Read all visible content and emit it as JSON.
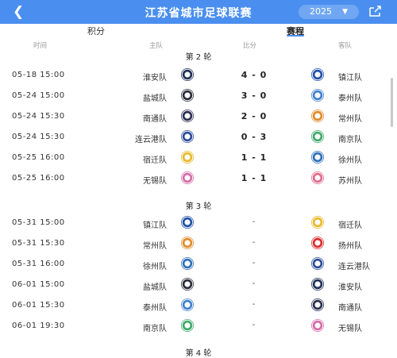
{
  "header": {
    "title": "江苏省城市足球联赛",
    "year": "2025",
    "back_icon": "chevron-left-icon",
    "share_icon": "share-icon"
  },
  "tabs": [
    {
      "label": "积分"
    },
    {
      "label": "赛程"
    }
  ],
  "columns": {
    "time": "时间",
    "home": "主队",
    "score": "比分",
    "away": "客队"
  },
  "rounds": {
    "r2": "第 2 轮",
    "r3": "第 3 轮",
    "r4": "第 4 轮"
  },
  "round2": [
    {
      "time": "05-18 15:00",
      "home": "淮安队",
      "score": "4 - 0",
      "away": "镇江队"
    },
    {
      "time": "05-24 15:00",
      "home": "盐城队",
      "score": "3 - 0",
      "away": "泰州队"
    },
    {
      "time": "05-24 15:30",
      "home": "南通队",
      "score": "2 - 0",
      "away": "常州队"
    },
    {
      "time": "05-24 15:30",
      "home": "连云港队",
      "score": "0 - 3",
      "away": "南京队"
    },
    {
      "time": "05-25 16:00",
      "home": "宿迁队",
      "score": "1 - 1",
      "away": "徐州队"
    },
    {
      "time": "05-25 16:00",
      "home": "无锡队",
      "score": "1 - 1",
      "away": "苏州队"
    }
  ],
  "round3": [
    {
      "time": "05-31 15:00",
      "home": "镇江队",
      "score": "-",
      "away": "宿迁队"
    },
    {
      "time": "05-31 15:30",
      "home": "常州队",
      "score": "-",
      "away": "扬州队"
    },
    {
      "time": "05-31 16:00",
      "home": "徐州队",
      "score": "-",
      "away": "连云港队"
    },
    {
      "time": "06-01 15:00",
      "home": "盐城队",
      "score": "-",
      "away": "淮安队"
    },
    {
      "time": "06-01 15:30",
      "home": "泰州队",
      "score": "-",
      "away": "南通队"
    },
    {
      "time": "06-01 19:30",
      "home": "南京队",
      "score": "-",
      "away": "无锡队"
    }
  ],
  "team_colors": {
    "淮安队": "#1f2f55",
    "镇江队": "#1f4fa8",
    "盐城队": "#2a2a3a",
    "泰州队": "#3f7fd0",
    "南通队": "#2a2f50",
    "常州队": "#e08a2a",
    "连云港队": "#2b4b9a",
    "南京队": "#3fa96a",
    "宿迁队": "#e8b828",
    "徐州队": "#2f6fb8",
    "无锡队": "#d46aa8",
    "苏州队": "#e06a8a",
    "扬州队": "#d92a2a"
  }
}
